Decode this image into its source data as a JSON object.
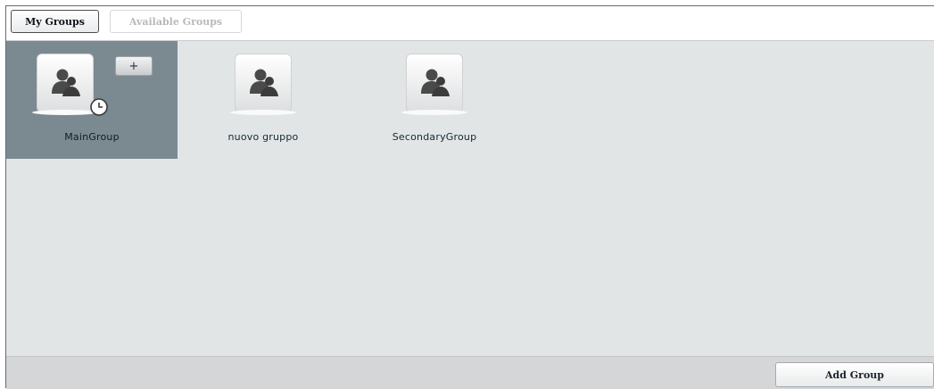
{
  "tabs": [
    {
      "label": "My Groups",
      "active": true
    },
    {
      "label": "Available Groups",
      "active": false
    }
  ],
  "groups": [
    {
      "name": "MainGroup",
      "selected": true,
      "icon": "people-icon",
      "status_icon": "clock-icon"
    },
    {
      "name": "nuovo gruppo",
      "selected": false,
      "icon": "people-icon"
    },
    {
      "name": "SecondaryGroup",
      "selected": false,
      "icon": "people-icon"
    }
  ],
  "selected_actions": {
    "add_label": "+"
  },
  "footer": {
    "add_group_label": "Add Group"
  },
  "colors": {
    "selected_bg": "#7b8a91",
    "content_bg": "#e2e5e6",
    "footer_bg": "#d4d6d7",
    "icon_dark": "#4a4a4a"
  }
}
